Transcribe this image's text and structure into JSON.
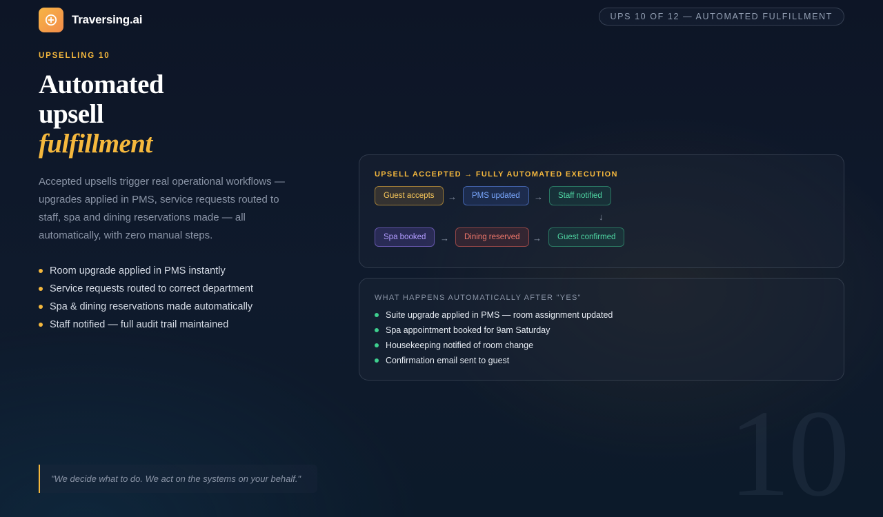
{
  "header": {
    "brand": "Traversing.ai",
    "logo_icon": "circle-plus-icon",
    "progress_pill": "UPS 10 OF 12 — AUTOMATED FULFILLMENT"
  },
  "hero": {
    "eyebrow": "UPSELLING 10",
    "title_line1": "Automated",
    "title_line2": "upsell",
    "title_accent": "fulfillment",
    "description": "Accepted upsells trigger real operational workflows — upgrades applied in PMS, service requests routed to staff, spa and dining reservations made — all automatically, with zero manual steps.",
    "bullets": [
      "Room upgrade applied in PMS instantly",
      "Service requests routed to correct department",
      "Spa & dining reservations made automatically",
      "Staff notified — full audit trail maintained"
    ],
    "quote": "\"We decide what to do. We act on the systems on your behalf.\"",
    "slide_number": "10"
  },
  "flow_card": {
    "label": "UPSELL ACCEPTED → FULLY AUTOMATED EXECUTION",
    "steps": [
      "Guest accepts",
      "PMS updated",
      "Staff notified",
      "Spa booked",
      "Dining reserved",
      "Guest confirmed"
    ],
    "arrow_right": "→",
    "arrow_down": "↓"
  },
  "auto_card": {
    "label": "WHAT HAPPENS AUTOMATICALLY AFTER \"YES\"",
    "items": [
      "Suite upgrade applied in PMS — room assignment updated",
      "Spa appointment booked for 9am Saturday",
      "Housekeeping notified of room change",
      "Confirmation email sent to guest"
    ]
  },
  "colors": {
    "accent": "#f5b83d",
    "success": "#3ecf8e",
    "background": "#0d1526"
  }
}
